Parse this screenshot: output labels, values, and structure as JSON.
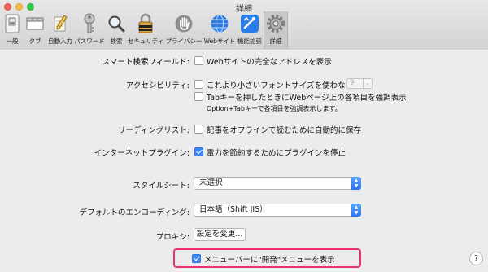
{
  "window": {
    "title": "詳細"
  },
  "toolbar": {
    "items": [
      {
        "label": "一般",
        "icon": "general-switch-icon"
      },
      {
        "label": "タブ",
        "icon": "tabs-icon"
      },
      {
        "label": "自動入力",
        "icon": "autofill-pencil-icon"
      },
      {
        "label": "パスワード",
        "icon": "key-icon"
      },
      {
        "label": "検索",
        "icon": "magnifier-icon"
      },
      {
        "label": "セキュリティ",
        "icon": "padlock-icon"
      },
      {
        "label": "プライバシー",
        "icon": "hand-icon"
      },
      {
        "label": "Webサイト",
        "icon": "globe-icon"
      },
      {
        "label": "機能拡張",
        "icon": "extensions-icon"
      },
      {
        "label": "詳細",
        "icon": "gear-icon",
        "active": true
      }
    ]
  },
  "smart_search": {
    "label": "スマート検索フィールド:",
    "option": "Webサイトの完全なアドレスを表示",
    "checked": false
  },
  "accessibility": {
    "label": "アクセシビリティ:",
    "font_option": "これより小さいフォントサイズを使わない:",
    "font_checked": false,
    "font_size_value": "9",
    "tab_option": "Tabキーを押したときにWebページ上の各項目を強調表示",
    "tab_checked": false,
    "note": "Option+Tabキーで各項目を強調表示します。"
  },
  "reading_list": {
    "label": "リーディングリスト:",
    "option": "記事をオフラインで読むために自動的に保存",
    "checked": false
  },
  "plugins": {
    "label": "インターネットプラグイン:",
    "option": "電力を節約するためにプラグインを停止",
    "checked": true
  },
  "stylesheet": {
    "label": "スタイルシート:",
    "value": "未選択"
  },
  "encoding": {
    "label": "デフォルトのエンコーディング:",
    "value": "日本語（Shift JIS）"
  },
  "proxy": {
    "label": "プロキシ:",
    "button": "設定を変更..."
  },
  "develop_menu": {
    "option": "メニューバーに\"開発\"メニューを表示",
    "checked": true
  },
  "help": {
    "label": "?"
  },
  "colors": {
    "accent": "#3b88fd",
    "highlight": "#e8336e"
  }
}
